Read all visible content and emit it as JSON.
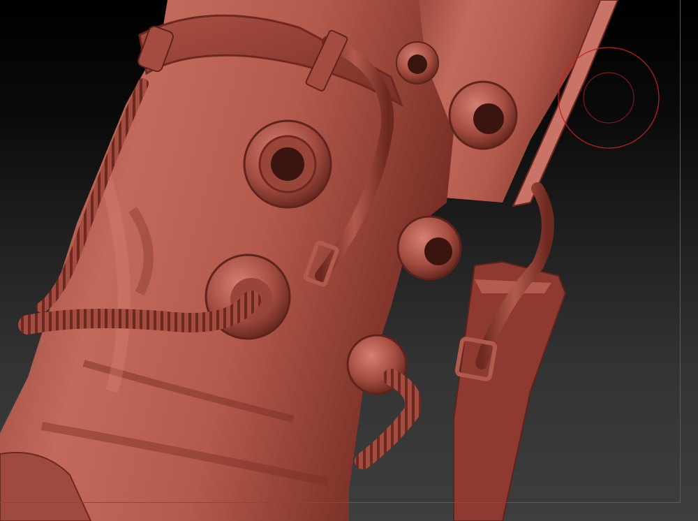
{
  "viewport": {
    "background_top": "#000000",
    "background_bottom": "#3e3e3e"
  },
  "model": {
    "material_color": "#b5574a",
    "shadow_color": "#5e231c",
    "highlight_color": "#d98476"
  },
  "cursor": {
    "icon": "brush-cursor-icon",
    "outer_ring_color": "#c81e1e",
    "inner_ring_color": "#9a1a1a"
  }
}
